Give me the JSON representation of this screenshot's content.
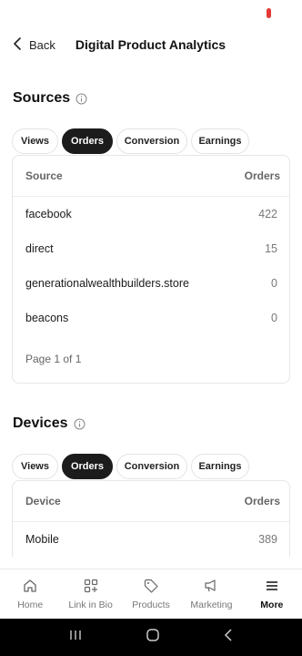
{
  "header": {
    "back_label": "Back",
    "title": "Digital Product Analytics"
  },
  "tabs": [
    {
      "label": "Views"
    },
    {
      "label": "Orders"
    },
    {
      "label": "Conversion"
    },
    {
      "label": "Earnings"
    }
  ],
  "sources": {
    "title": "Sources",
    "active_tab": "Orders",
    "columns": [
      "Source",
      "Orders"
    ],
    "rows": [
      {
        "name": "facebook",
        "value": "422"
      },
      {
        "name": "direct",
        "value": "15"
      },
      {
        "name": "generationalwealthbuilders.store",
        "value": "0"
      },
      {
        "name": "beacons",
        "value": "0"
      }
    ],
    "pagination": "Page 1 of 1"
  },
  "devices": {
    "title": "Devices",
    "active_tab": "Orders",
    "columns": [
      "Device",
      "Orders"
    ],
    "rows": [
      {
        "name": "Mobile",
        "value": "389"
      }
    ]
  },
  "bottom_nav": [
    {
      "label": "Home",
      "icon": "home-icon"
    },
    {
      "label": "Link in Bio",
      "icon": "link-in-bio-icon"
    },
    {
      "label": "Products",
      "icon": "tag-icon"
    },
    {
      "label": "Marketing",
      "icon": "megaphone-icon"
    },
    {
      "label": "More",
      "icon": "menu-icon",
      "active": true
    }
  ],
  "colors": {
    "accent_dark": "#1c1c1c",
    "recording_dot": "#e53935",
    "border": "#e6e6e6"
  }
}
